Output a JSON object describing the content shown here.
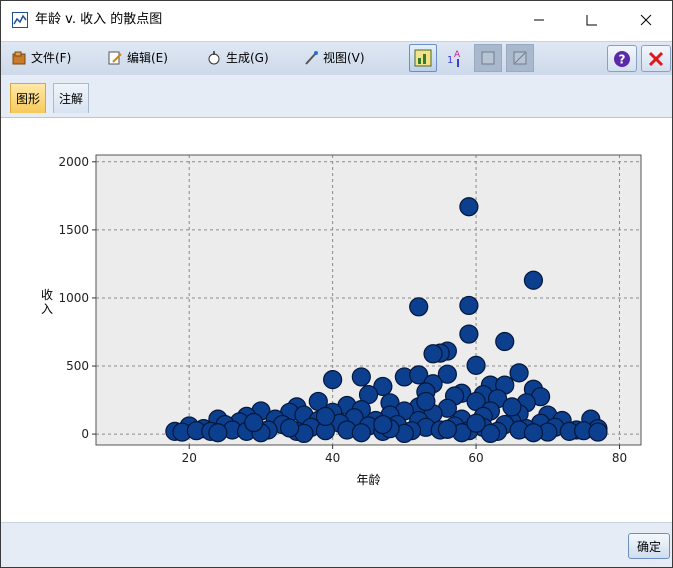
{
  "window": {
    "title": "年龄 v. 收入 的散点图"
  },
  "menu": [
    {
      "label": "文件(F)",
      "icon": "file-folder-icon"
    },
    {
      "label": "编辑(E)",
      "icon": "edit-pencil-icon"
    },
    {
      "label": "生成(G)",
      "icon": "generate-icon"
    },
    {
      "label": "视图(V)",
      "icon": "view-brush-icon"
    }
  ],
  "toolbar": {
    "buttons": [
      "graph-view-icon",
      "label-order-icon",
      "frame-icon",
      "diagonal-icon"
    ],
    "help_icon": "help-icon",
    "close_icon": "close-red-icon"
  },
  "tabs": [
    {
      "label": "图形",
      "selected": true
    },
    {
      "label": "注解",
      "selected": false
    }
  ],
  "footer": {
    "ok_label": "确定"
  },
  "colors": {
    "plot_background": "#ececec",
    "marker_fill": "#0d3f8f",
    "marker_stroke": "#03163a",
    "grid": "#8a8a8a"
  },
  "chart_data": {
    "type": "scatter",
    "xlabel": "年龄",
    "ylabel": "收入",
    "xlim": [
      7,
      83
    ],
    "ylim": [
      -80,
      2050
    ],
    "xticks": [
      20,
      40,
      60,
      80
    ],
    "yticks": [
      0,
      500,
      1000,
      1500,
      2000
    ],
    "grid": true,
    "legend": "none",
    "points": [
      [
        59,
        1670
      ],
      [
        68,
        1130
      ],
      [
        52,
        935
      ],
      [
        59,
        945
      ],
      [
        59,
        735
      ],
      [
        64,
        680
      ],
      [
        56,
        610
      ],
      [
        55,
        595
      ],
      [
        54,
        590
      ],
      [
        60,
        505
      ],
      [
        40,
        400
      ],
      [
        44,
        420
      ],
      [
        66,
        450
      ],
      [
        50,
        420
      ],
      [
        52,
        435
      ],
      [
        56,
        440
      ],
      [
        68,
        330
      ],
      [
        62,
        360
      ],
      [
        47,
        350
      ],
      [
        54,
        370
      ],
      [
        58,
        300
      ],
      [
        61,
        290
      ],
      [
        64,
        360
      ],
      [
        53,
        310
      ],
      [
        69,
        275
      ],
      [
        38,
        240
      ],
      [
        45,
        290
      ],
      [
        57,
        280
      ],
      [
        67,
        230
      ],
      [
        48,
        230
      ],
      [
        52,
        200
      ],
      [
        35,
        200
      ],
      [
        42,
        210
      ],
      [
        60,
        240
      ],
      [
        63,
        260
      ],
      [
        34,
        160
      ],
      [
        30,
        170
      ],
      [
        28,
        130
      ],
      [
        36,
        140
      ],
      [
        40,
        160
      ],
      [
        44,
        180
      ],
      [
        50,
        170
      ],
      [
        56,
        190
      ],
      [
        62,
        170
      ],
      [
        66,
        150
      ],
      [
        70,
        140
      ],
      [
        48,
        140
      ],
      [
        54,
        150
      ],
      [
        24,
        110
      ],
      [
        27,
        90
      ],
      [
        32,
        110
      ],
      [
        38,
        100
      ],
      [
        43,
        120
      ],
      [
        46,
        100
      ],
      [
        52,
        100
      ],
      [
        58,
        110
      ],
      [
        61,
        130
      ],
      [
        65,
        90
      ],
      [
        69,
        80
      ],
      [
        72,
        100
      ],
      [
        76,
        110
      ],
      [
        20,
        60
      ],
      [
        22,
        40
      ],
      [
        25,
        70
      ],
      [
        29,
        60
      ],
      [
        33,
        70
      ],
      [
        37,
        50
      ],
      [
        41,
        80
      ],
      [
        45,
        60
      ],
      [
        49,
        70
      ],
      [
        53,
        50
      ],
      [
        57,
        60
      ],
      [
        61,
        50
      ],
      [
        64,
        70
      ],
      [
        67,
        40
      ],
      [
        71,
        50
      ],
      [
        74,
        30
      ],
      [
        77,
        40
      ],
      [
        18,
        20
      ],
      [
        19,
        15
      ],
      [
        21,
        25
      ],
      [
        23,
        20
      ],
      [
        26,
        30
      ],
      [
        28,
        20
      ],
      [
        31,
        30
      ],
      [
        35,
        20
      ],
      [
        39,
        25
      ],
      [
        42,
        30
      ],
      [
        47,
        20
      ],
      [
        51,
        25
      ],
      [
        55,
        30
      ],
      [
        59,
        25
      ],
      [
        63,
        20
      ],
      [
        66,
        30
      ],
      [
        70,
        15
      ],
      [
        73,
        20
      ],
      [
        75,
        25
      ],
      [
        77,
        15
      ],
      [
        24,
        10
      ],
      [
        30,
        10
      ],
      [
        36,
        5
      ],
      [
        44,
        10
      ],
      [
        50,
        5
      ],
      [
        58,
        10
      ],
      [
        62,
        5
      ],
      [
        68,
        10
      ],
      [
        34,
        45
      ],
      [
        48,
        40
      ],
      [
        56,
        35
      ],
      [
        60,
        80
      ],
      [
        39,
        130
      ],
      [
        47,
        70
      ],
      [
        65,
        200
      ],
      [
        53,
        240
      ],
      [
        29,
        85
      ]
    ]
  }
}
